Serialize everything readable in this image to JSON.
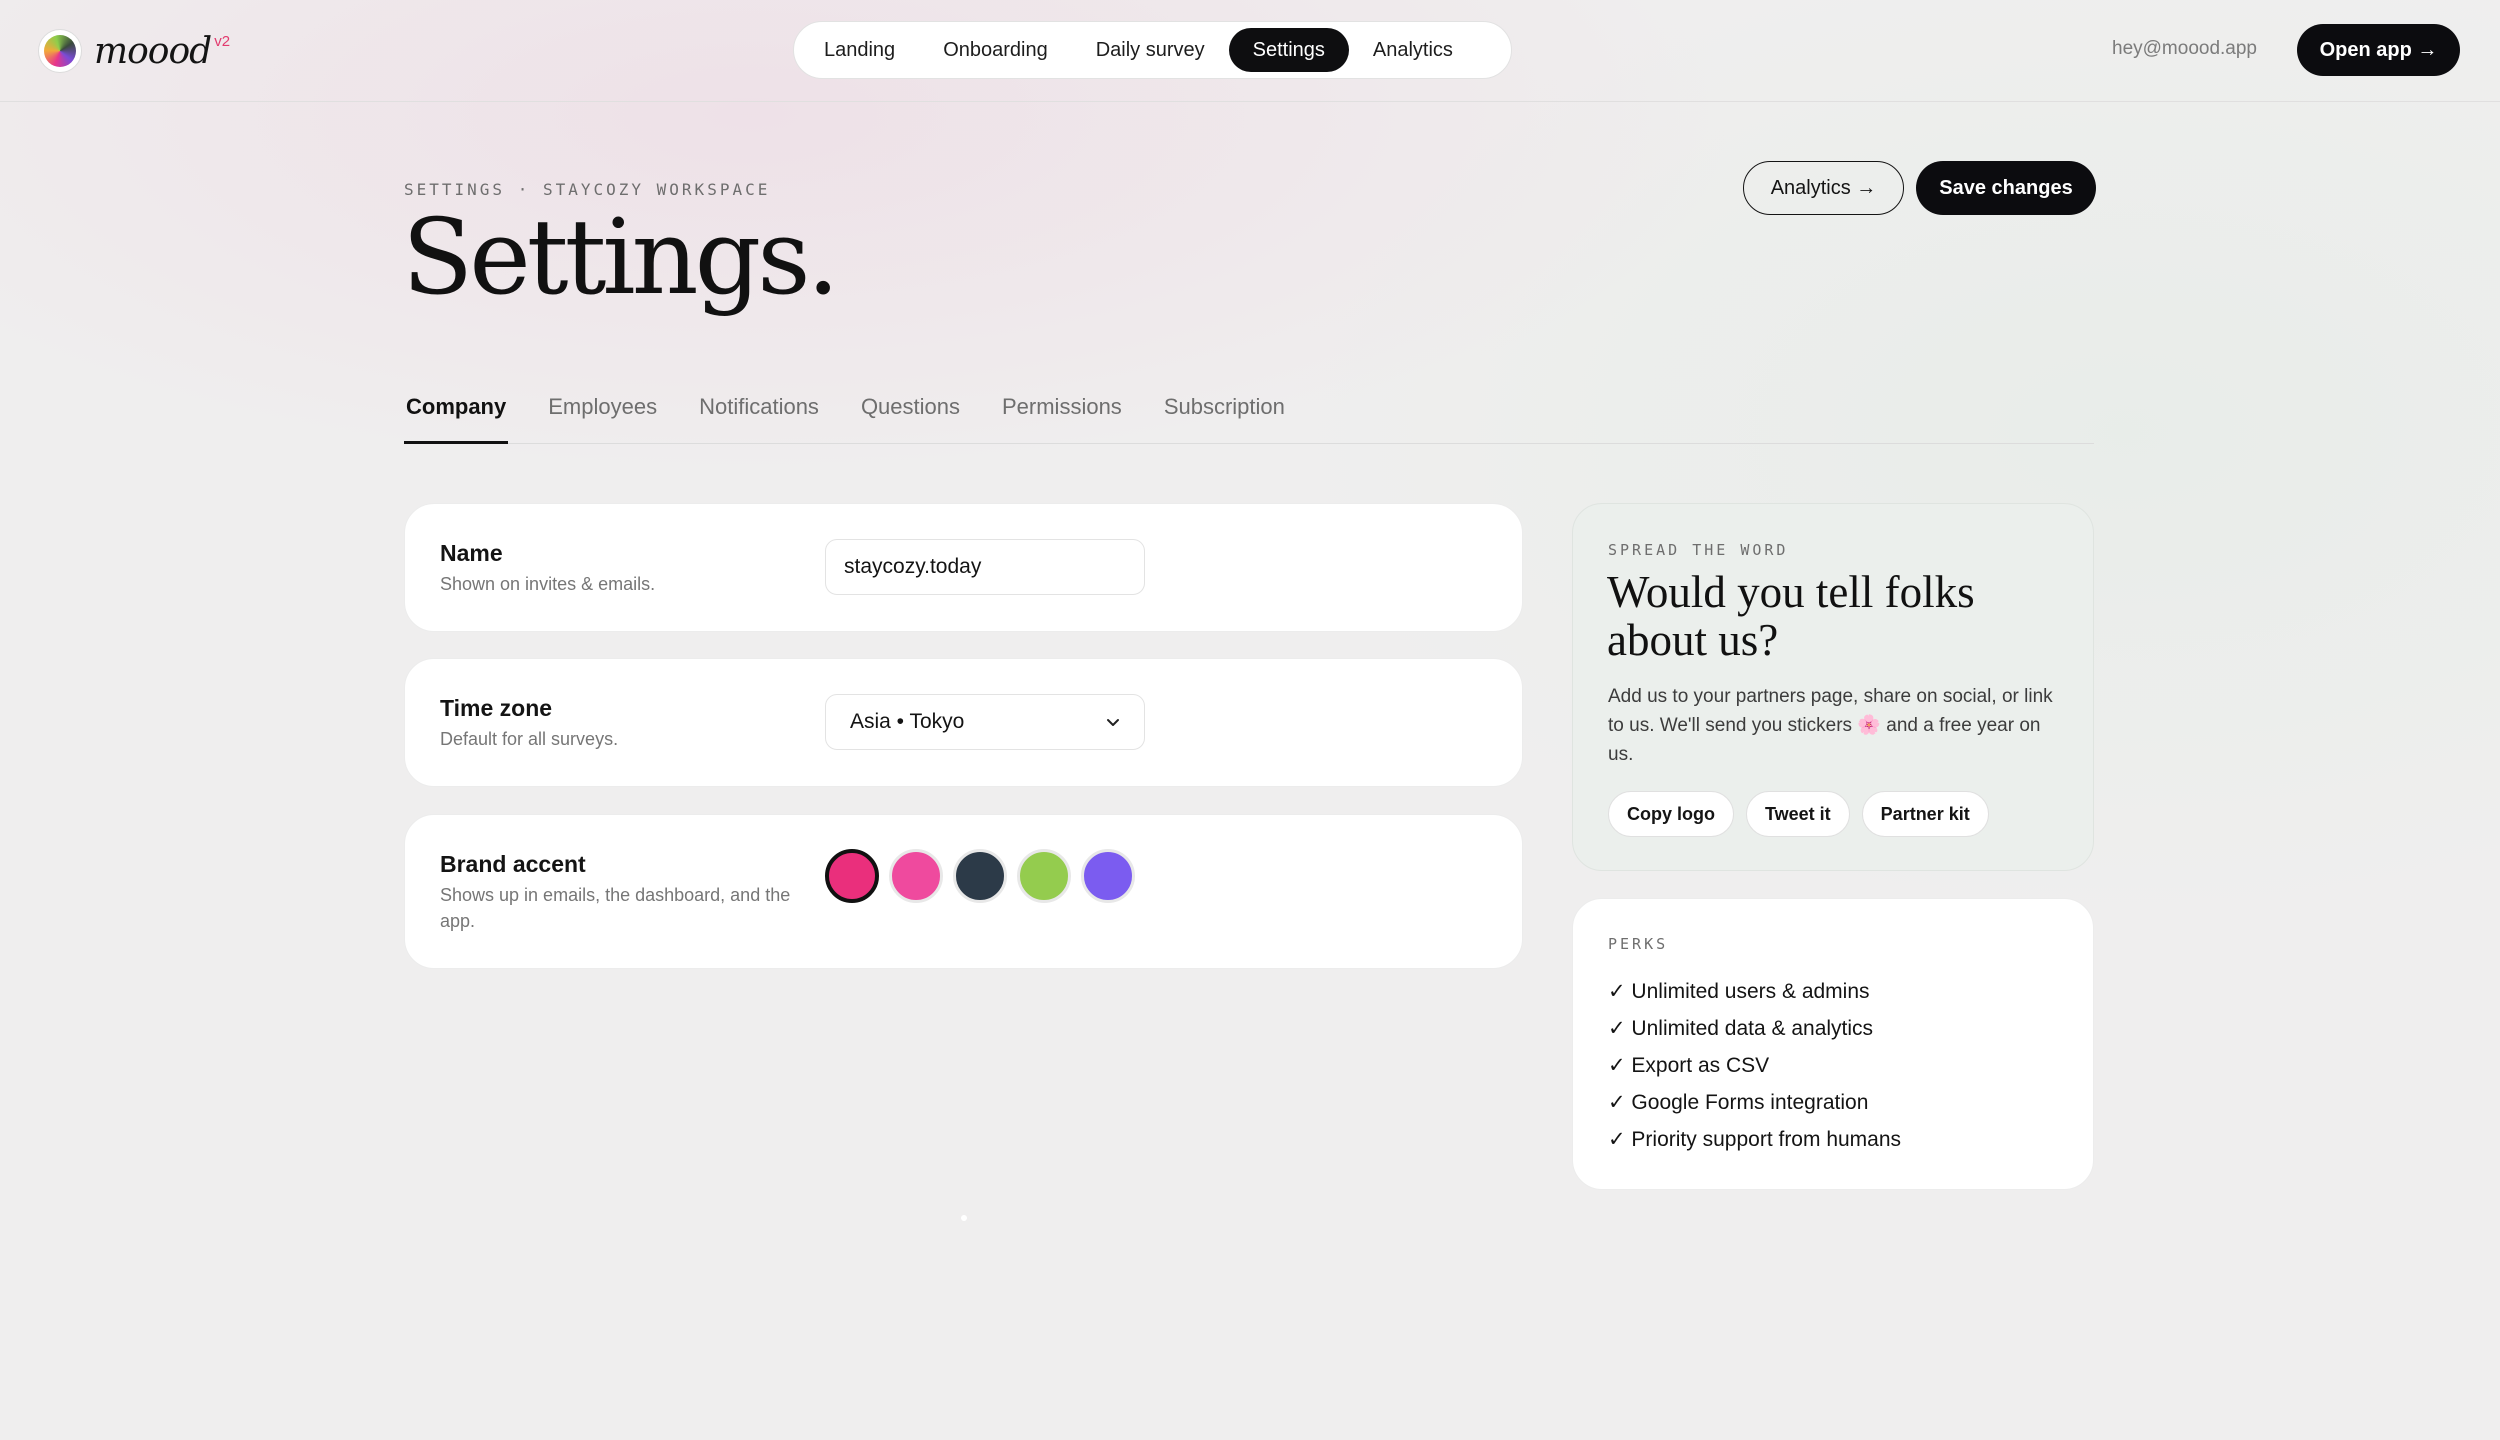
{
  "brand": {
    "name": "moood",
    "version": "v2"
  },
  "nav": {
    "items": [
      {
        "label": "Landing"
      },
      {
        "label": "Onboarding"
      },
      {
        "label": "Daily survey"
      },
      {
        "label": "Settings"
      },
      {
        "label": "Analytics"
      }
    ],
    "active": "Settings"
  },
  "header": {
    "email": "hey@moood.app",
    "open_app_label": "Open app →"
  },
  "page": {
    "eyebrow": "SETTINGS · STAYCOZY WORKSPACE",
    "title": "Settings.",
    "analytics_label": "Analytics →",
    "save_label": "Save changes"
  },
  "tabs": {
    "items": [
      {
        "label": "Company"
      },
      {
        "label": "Employees"
      },
      {
        "label": "Notifications"
      },
      {
        "label": "Questions"
      },
      {
        "label": "Permissions"
      },
      {
        "label": "Subscription"
      }
    ],
    "active": "Company"
  },
  "settings": {
    "name": {
      "label": "Name",
      "description": "Shown on invites & emails.",
      "value": "staycozy.today"
    },
    "timezone": {
      "label": "Time zone",
      "description": "Default for all surveys.",
      "value": "Asia • Tokyo"
    },
    "brand_accent": {
      "label": "Brand accent",
      "description": "Shows up in emails, the dashboard, and the app.",
      "swatches": [
        "#ea2f7c",
        "#ef4a9e",
        "#2c3a48",
        "#94cc4e",
        "#7b5cf0"
      ],
      "selected_index": 0
    }
  },
  "spread": {
    "kicker": "SPREAD THE WORD",
    "title": "Would you tell folks about us?",
    "body": "Add us to your partners page, share on social, or link to us. We'll send you stickers 🌸 and a free year on us.",
    "actions": [
      "Copy logo",
      "Tweet it",
      "Partner kit"
    ]
  },
  "perks": {
    "kicker": "PERKS",
    "items": [
      "✓ Unlimited users & admins",
      "✓ Unlimited data & analytics",
      "✓ Export as CSV",
      "✓ Google Forms integration",
      "✓ Priority support from humans"
    ]
  }
}
